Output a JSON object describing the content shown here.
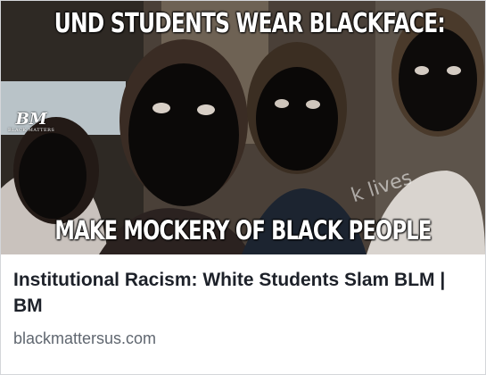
{
  "link_preview": {
    "image": {
      "headline_top": "UND STUDENTS WEAR BLACKFACE:",
      "headline_bottom": "MAKE MOCKERY OF BLACK PEOPLE",
      "logo_mark": "BM",
      "logo_subtext": "BLACK MATTERS",
      "watermark_text": "k lives"
    },
    "title": "Institutional Racism: White Students Slam BLM | BM",
    "domain": "blackmattersus.com"
  },
  "colors": {
    "title": "#1d2129",
    "domain": "#606770",
    "border": "#d4d6da"
  }
}
